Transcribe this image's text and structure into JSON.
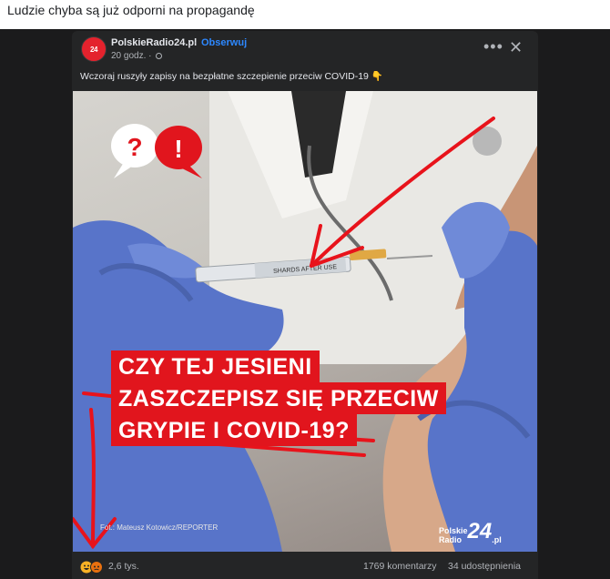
{
  "caption": "Ludzie chyba są już odporni na propagandę",
  "post": {
    "page_name": "PolskieRadio24.pl",
    "separator": "·",
    "follow_label": "Obserwuj",
    "time": "20 godz. ·",
    "avatar_text": "24",
    "more_icon": "more-horizontal-icon",
    "close_icon": "close-icon",
    "text": "Wczoraj ruszyły zapisy na bezpłatne szczepienie przeciw COVID-19",
    "text_emoji": "👇",
    "more_glyph": "•••",
    "close_glyph": "✕"
  },
  "image": {
    "headline_lines": [
      "CZY TEJ JESIENI",
      "ZASZCZEPISZ SIĘ PRZECIW",
      "GRYPIE I COVID-19?"
    ],
    "credit": "Fot.: Mateusz Kotowicz/REPORTER",
    "brand_small_1": "Polskie",
    "brand_small_2": "Radio",
    "brand_big": "24",
    "brand_suffix": ".pl",
    "syringe_text": "SHARDS AFTER USE",
    "question_mark": "?",
    "exclamation_mark": "!"
  },
  "stats": {
    "reactions": "2,6 tys.",
    "comments": "1769 komentarzy",
    "shares": "34 udostępnienia"
  },
  "colors": {
    "accent_red": "#e1151d",
    "annotation_red": "#e8131b",
    "facebook_blue": "#2d88ff",
    "glove_blue": "#5874c9"
  }
}
